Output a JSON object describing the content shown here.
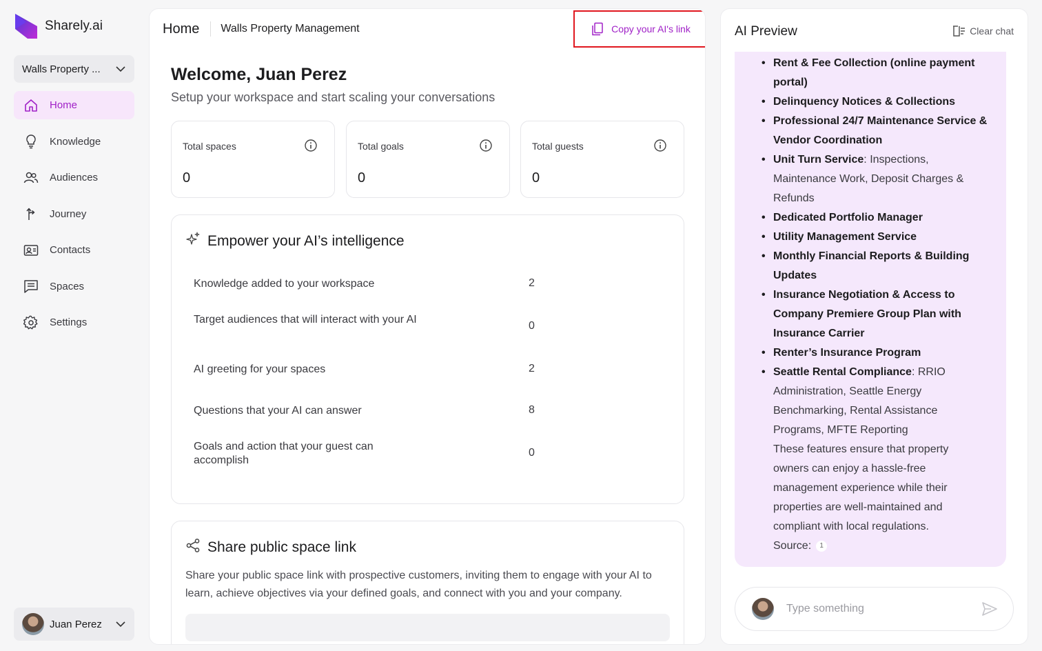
{
  "brand": {
    "name": "Sharely.ai"
  },
  "workspace_select": {
    "label": "Walls Property ..."
  },
  "nav": [
    {
      "label": "Home",
      "icon": "home-icon",
      "active": true
    },
    {
      "label": "Knowledge",
      "icon": "lightbulb-icon"
    },
    {
      "label": "Audiences",
      "icon": "users-icon"
    },
    {
      "label": "Journey",
      "icon": "journey-icon"
    },
    {
      "label": "Contacts",
      "icon": "contact-card-icon"
    },
    {
      "label": "Spaces",
      "icon": "chat-icon"
    },
    {
      "label": "Settings",
      "icon": "gear-icon"
    }
  ],
  "user": {
    "name": "Juan Perez"
  },
  "header": {
    "home": "Home",
    "workspace": "Walls Property Management",
    "copy_link": "Copy your AI's link"
  },
  "welcome": {
    "title": "Welcome, Juan Perez",
    "subtitle": "Setup your workspace and start scaling your conversations"
  },
  "stats": [
    {
      "label": "Total spaces",
      "value": "0"
    },
    {
      "label": "Total goals",
      "value": "0"
    },
    {
      "label": "Total guests",
      "value": "0"
    }
  ],
  "intelligence": {
    "title": "Empower your AI’s intelligence",
    "rows": [
      {
        "label": "Knowledge added to your workspace",
        "value": "2"
      },
      {
        "label": "Target audiences that will interact with your AI",
        "value": "0"
      },
      {
        "label": "AI greeting for your spaces",
        "value": "2"
      },
      {
        "label": "Questions that your AI can answer",
        "value": "8"
      },
      {
        "label": "Goals and action that your guest can accomplish",
        "value": "0"
      }
    ]
  },
  "share": {
    "title": "Share public space link",
    "description": "Share your public space link with prospective customers, inviting them to engage with your AI to learn, achieve objectives via your defined goals, and connect with you and your company."
  },
  "preview": {
    "title": "AI Preview",
    "clear_chat": "Clear chat",
    "bullets": [
      {
        "bold": "Rent & Fee Collection (online payment portal)",
        "rest": ""
      },
      {
        "bold": "Delinquency Notices & Collections",
        "rest": ""
      },
      {
        "bold": "Professional 24/7 Maintenance Service & Vendor Coordination",
        "rest": ""
      },
      {
        "bold": "Unit Turn Service",
        "rest": ": Inspections, Maintenance Work, Deposit Charges & Refunds"
      },
      {
        "bold": "Dedicated Portfolio Manager",
        "rest": ""
      },
      {
        "bold": "Utility Management Service",
        "rest": ""
      },
      {
        "bold": "Monthly Financial Reports & Building Updates",
        "rest": ""
      },
      {
        "bold": "Insurance Negotiation & Access to Company Premiere Group Plan with Insurance Carrier",
        "rest": ""
      },
      {
        "bold": "Renter’s Insurance Program",
        "rest": ""
      },
      {
        "bold": "Seattle Rental Compliance",
        "rest": ": RRIO Administration, Seattle Energy Benchmarking, Rental Assistance Programs, MFTE Reporting"
      }
    ],
    "closing": "These features ensure that property owners can enjoy a hassle-free management experience while their properties are well-maintained and compliant with local regulations.",
    "source_label": "Source:",
    "source_number": "1",
    "input_placeholder": "Type something"
  },
  "colors": {
    "accent": "#a021c7",
    "active_bg": "#f7e6fb",
    "bubble_bg": "#f5e8fc",
    "highlight": "#e0161e"
  }
}
